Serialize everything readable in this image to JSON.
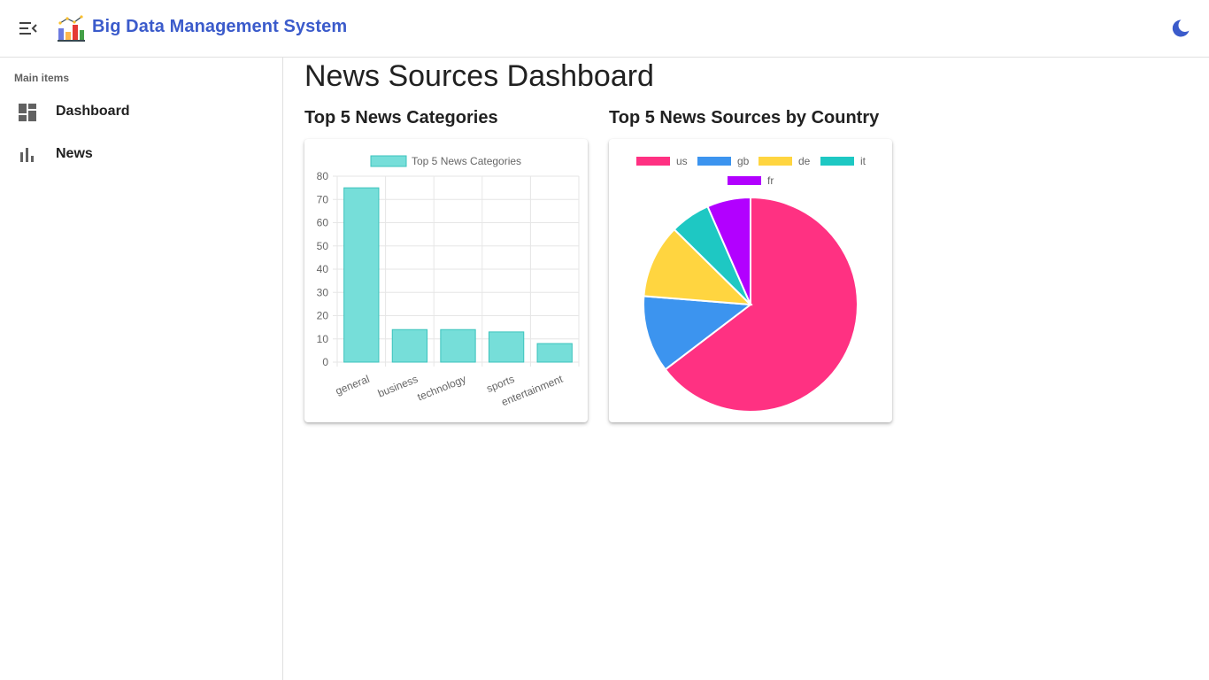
{
  "app": {
    "title": "Big Data Management System",
    "menu_icon": "menu-open-icon",
    "logo_icon": "bar-chart-logo-icon",
    "theme_icon": "dark-mode-moon-icon",
    "accent_color": "#3b5bcb"
  },
  "sidebar": {
    "subheader": "Main items",
    "items": [
      {
        "label": "Dashboard",
        "icon": "dashboard-icon"
      },
      {
        "label": "News",
        "icon": "bar-chart-icon"
      }
    ]
  },
  "page": {
    "title": "News Sources Dashboard",
    "sections": [
      {
        "title": "Top 5 News Categories"
      },
      {
        "title": "Top 5 News Sources by Country"
      }
    ]
  },
  "chart_data": [
    {
      "type": "bar",
      "legend": [
        "Top 5 News Categories"
      ],
      "series": [
        {
          "name": "Top 5 News Categories",
          "values": [
            75,
            14,
            14,
            13,
            8
          ]
        }
      ],
      "categories": [
        "general",
        "business",
        "technology",
        "sports",
        "entertainment"
      ],
      "ylim": [
        0,
        80
      ],
      "yticks": [
        0,
        10,
        20,
        30,
        40,
        50,
        60,
        70,
        80
      ],
      "grid": true,
      "legend_position": "top",
      "color": "#76ded9",
      "border_color": "#3cc3bd"
    },
    {
      "type": "pie",
      "labels": [
        "us",
        "gb",
        "de",
        "it",
        "fr"
      ],
      "values": [
        64,
        11.5,
        11,
        6,
        6.5
      ],
      "colors": [
        "#ff3182",
        "#3c94ef",
        "#ffd540",
        "#1ec8c3",
        "#b200ff"
      ],
      "legend_position": "top"
    }
  ]
}
